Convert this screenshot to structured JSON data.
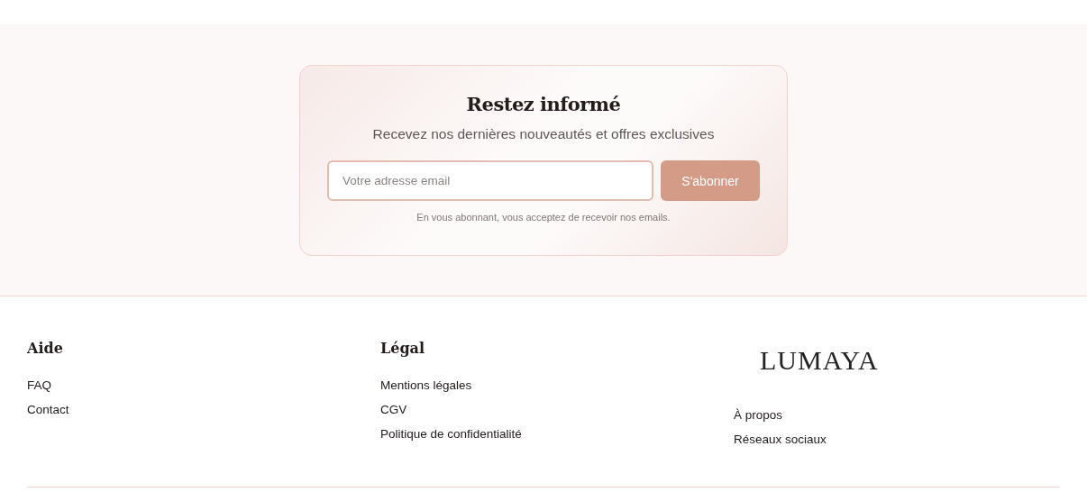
{
  "newsletter": {
    "title": "Restez informé",
    "subtitle": "Recevez nos dernières nouveautés et offres exclusives",
    "email": {
      "placeholder": "Votre adresse email"
    },
    "button": "S'abonner",
    "note": "En vous abonnant, vous acceptez de recevoir nos emails."
  },
  "footer": {
    "columns": [
      {
        "kind": "links",
        "heading": "Aide",
        "links": [
          "FAQ",
          "Contact"
        ]
      },
      {
        "kind": "links",
        "heading": "Légal",
        "links": [
          "Mentions légales",
          "CGV",
          "Politique de confidentialité"
        ]
      },
      {
        "kind": "brand",
        "logo": "LUMAYA",
        "links": [
          "À propos",
          "Réseaux sociaux"
        ]
      }
    ]
  }
}
